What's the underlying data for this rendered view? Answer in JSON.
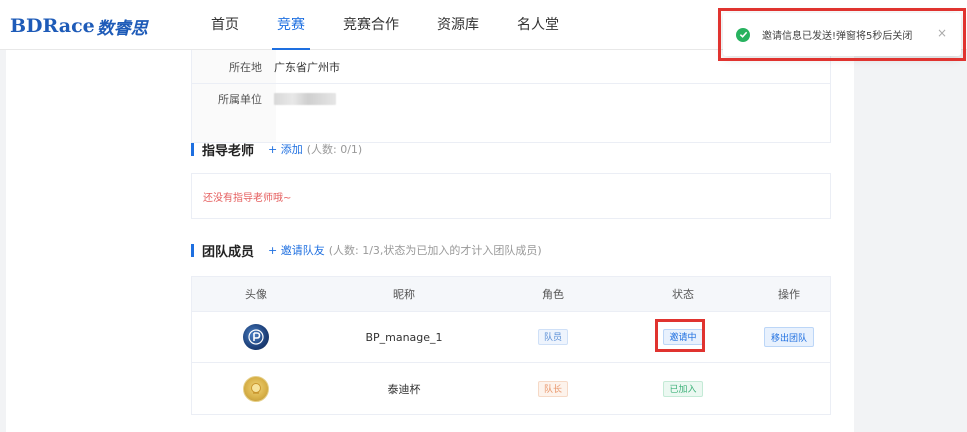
{
  "logo": {
    "en": "BDRace",
    "cn": "数睿思"
  },
  "nav": {
    "items": [
      {
        "label": "首页"
      },
      {
        "label": "竞赛"
      },
      {
        "label": "竞赛合作"
      },
      {
        "label": "资源库"
      },
      {
        "label": "名人堂"
      }
    ],
    "active_index": 1
  },
  "info": {
    "location_key": "所在地",
    "location_value": "广东省广州市",
    "unit_key": "所属单位"
  },
  "advisors": {
    "title": "指导老师",
    "action": "+ 添加",
    "hint": "(人数: 0/1)",
    "empty_text": "还没有指导老师哦~"
  },
  "members": {
    "title": "团队成员",
    "action": "+ 邀请队友",
    "hint": "(人数: 1/3,状态为已加入的才计入团队成员)",
    "columns": [
      "头像",
      "昵称",
      "角色",
      "状态",
      "操作"
    ],
    "rows": [
      {
        "nickname": "BP_manage_1",
        "role": "队员",
        "status": "邀请中",
        "action": "移出团队"
      },
      {
        "nickname": "泰迪杯",
        "role": "队长",
        "status": "已加入",
        "action": ""
      }
    ]
  },
  "toast": {
    "message": "邀请信息已发送!弹窗将5秒后关闭",
    "close": "×"
  },
  "colors": {
    "accent": "#1e6fe0",
    "highlight": "#e0332f",
    "success": "#27b25f"
  }
}
